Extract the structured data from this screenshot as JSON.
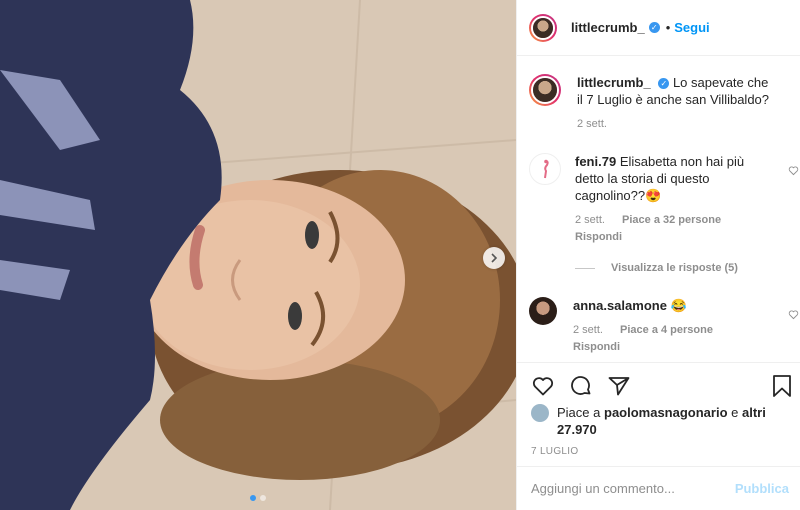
{
  "header": {
    "username": "littlecrumb_",
    "follow_label": "Segui",
    "separator": "•"
  },
  "caption": {
    "username": "littlecrumb_",
    "text": "Lo sapevate che il 7 Luglio è anche san Villibaldo?",
    "time": "2 sett."
  },
  "comments": [
    {
      "username": "feni.79",
      "text": "Elisabetta non hai più detto la storia di questo cagnolino??😍",
      "time": "2 sett.",
      "likes": "Piace a 32 persone",
      "reply": "Rispondi"
    },
    {
      "username": "anna.salamone",
      "text": "😂",
      "time": "2 sett.",
      "likes": "Piace a 4 persone",
      "reply": "Rispondi"
    }
  ],
  "view_replies": "Visualizza le risposte (5)",
  "likes": {
    "prefix": "Piace a",
    "user": "paolomasnagonario",
    "connector": "e",
    "others": "altri 27.970"
  },
  "post_date": "7 LUGLIO",
  "add_comment": {
    "placeholder": "Aggiungi un commento...",
    "publish": "Pubblica"
  },
  "icons": {
    "like": "heart-icon",
    "comment": "comment-icon",
    "share": "paper-plane-icon",
    "save": "bookmark-icon",
    "next": "chevron-right-icon",
    "verified": "verified-badge-icon"
  },
  "carousel": {
    "count": 2,
    "active": 1
  },
  "colors": {
    "link": "#0095f6",
    "verified": "#3897f0",
    "muted": "#8e8e8e",
    "publish_disabled": "#b2dffc"
  }
}
